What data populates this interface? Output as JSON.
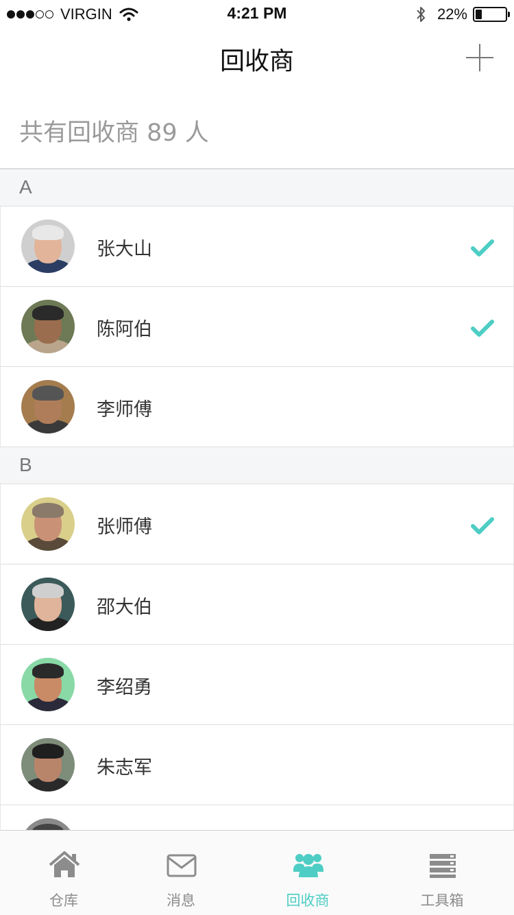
{
  "status_bar": {
    "carrier": "VIRGIN",
    "time": "4:21 PM",
    "battery_text": "22%",
    "battery_level": 0.22,
    "signal_bars": 3,
    "signal_total": 5
  },
  "nav": {
    "title": "回收商",
    "add_icon": "plus-icon"
  },
  "summary": "共有回收商 89 人",
  "sections": [
    {
      "letter": "A",
      "items": [
        {
          "name": "张大山",
          "checked": true
        },
        {
          "name": "陈阿伯",
          "checked": true
        },
        {
          "name": "李师傅",
          "checked": false
        }
      ]
    },
    {
      "letter": "B",
      "items": [
        {
          "name": "张师傅",
          "checked": true
        },
        {
          "name": "邵大伯",
          "checked": false
        },
        {
          "name": "李绍勇",
          "checked": false
        },
        {
          "name": "朱志军",
          "checked": false
        },
        {
          "name": "",
          "checked": false
        }
      ]
    }
  ],
  "tabs": [
    {
      "label": "仓库",
      "icon": "house-icon",
      "active": false
    },
    {
      "label": "消息",
      "icon": "envelope-icon",
      "active": false
    },
    {
      "label": "回收商",
      "icon": "group-icon",
      "active": true
    },
    {
      "label": "工具箱",
      "icon": "server-icon",
      "active": false
    }
  ],
  "colors": {
    "accent": "#4ecdc4",
    "inactive": "#8c8c8c",
    "section_bg": "#f5f6f8"
  }
}
